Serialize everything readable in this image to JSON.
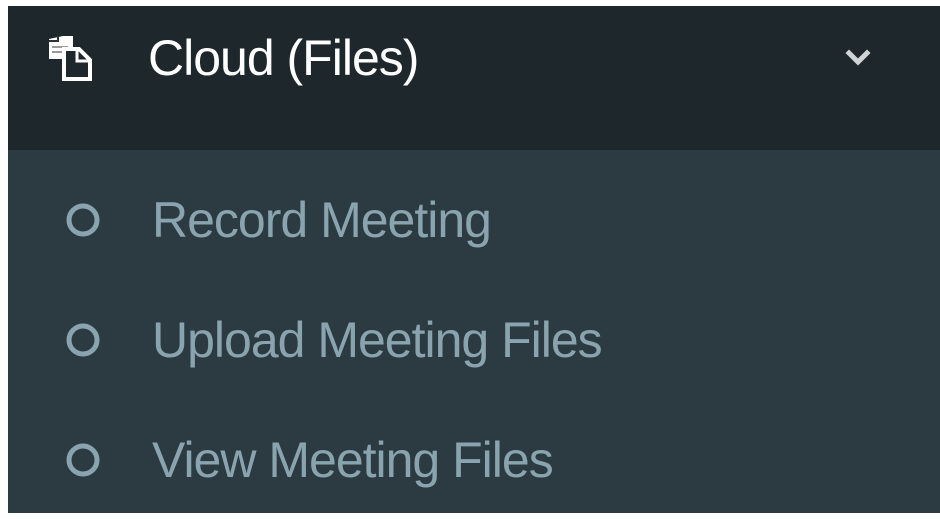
{
  "menu": {
    "header": {
      "icon": "copy-files-icon",
      "title": "Cloud (Files)",
      "toggle_icon": "chevron-down-icon"
    },
    "items": [
      {
        "label": "Record Meeting",
        "icon": "circle-outline-icon"
      },
      {
        "label": "Upload Meeting Files",
        "icon": "circle-outline-icon"
      },
      {
        "label": "View Meeting Files",
        "icon": "circle-outline-icon"
      }
    ]
  },
  "colors": {
    "header_background": "#1e282c",
    "submenu_background": "#2c3b41",
    "header_text": "#ffffff",
    "item_text": "#8aa4af"
  }
}
